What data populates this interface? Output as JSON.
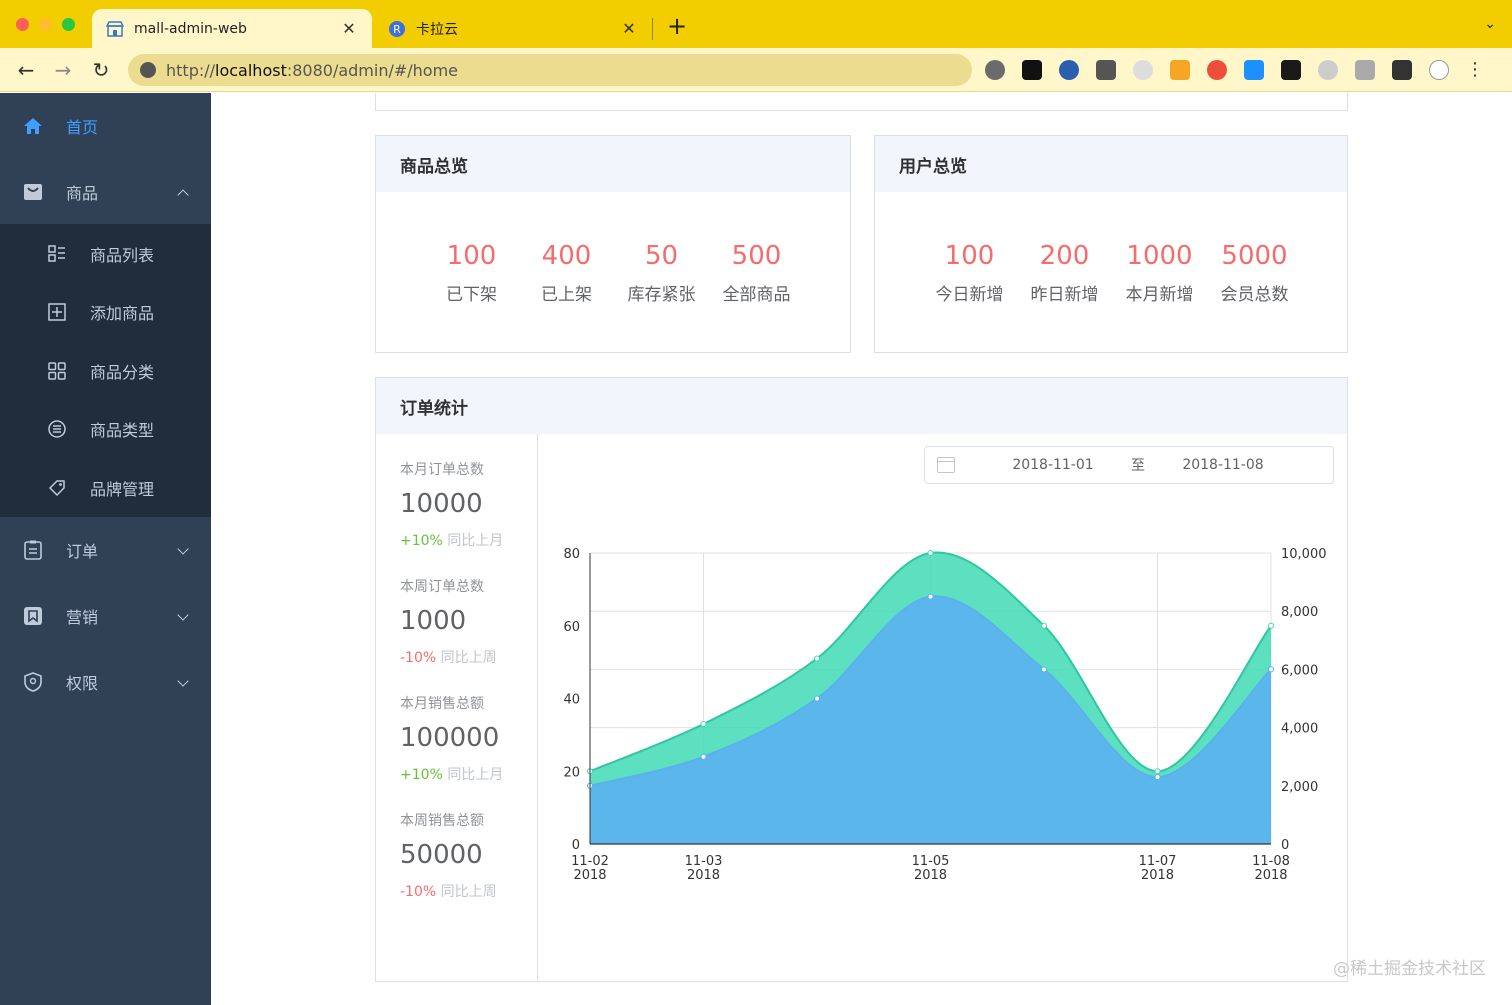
{
  "browser": {
    "tabs": [
      {
        "title": "mall-admin-web",
        "active": true
      },
      {
        "title": "卡拉云",
        "active": false
      }
    ],
    "new_tab": "+",
    "close_glyph": "✕",
    "url_prefix": "http://",
    "url_host": "localhost",
    "url_rest": ":8080/admin/#/home",
    "extensions": [
      "tomato-icon",
      "notion-icon",
      "password-icon",
      "mail-icon",
      "leaf-icon",
      "grid-icon",
      "translate-icon",
      "blue-ext-icon",
      "dark-ext-icon",
      "cloud-icon",
      "chat-icon",
      "puzzle-icon",
      "avatar-icon"
    ]
  },
  "sidebar": {
    "items": [
      {
        "label": "首页",
        "icon": "home-icon",
        "active": true
      },
      {
        "label": "商品",
        "icon": "bag-icon",
        "expanded": true
      },
      {
        "label": "订单",
        "icon": "clipboard-icon"
      },
      {
        "label": "营销",
        "icon": "bookmark-icon"
      },
      {
        "label": "权限",
        "icon": "shield-icon"
      }
    ],
    "sub_items": [
      {
        "label": "商品列表",
        "icon": "list-icon"
      },
      {
        "label": "添加商品",
        "icon": "add-square-icon"
      },
      {
        "label": "商品分类",
        "icon": "grid-icon"
      },
      {
        "label": "商品类型",
        "icon": "menu-circle-icon"
      },
      {
        "label": "品牌管理",
        "icon": "tag-icon"
      }
    ],
    "colors": {
      "bg": "#304156",
      "sub_bg": "#1f2d3d",
      "text": "#bfcbd9",
      "active": "#409eff"
    }
  },
  "product_overview": {
    "title": "商品总览",
    "stats": [
      {
        "value": "100",
        "label": "已下架"
      },
      {
        "value": "400",
        "label": "已上架"
      },
      {
        "value": "50",
        "label": "库存紧张"
      },
      {
        "value": "500",
        "label": "全部商品"
      }
    ]
  },
  "user_overview": {
    "title": "用户总览",
    "stats": [
      {
        "value": "100",
        "label": "今日新增"
      },
      {
        "value": "200",
        "label": "昨日新增"
      },
      {
        "value": "1000",
        "label": "本月新增"
      },
      {
        "value": "5000",
        "label": "会员总数"
      }
    ]
  },
  "order_stats": {
    "title": "订单统计",
    "items": [
      {
        "title": "本月订单总数",
        "value": "10000",
        "pct": "+10%",
        "cmp": "同比上月",
        "trend": "up"
      },
      {
        "title": "本周订单总数",
        "value": "1000",
        "pct": "-10%",
        "cmp": "同比上周",
        "trend": "down"
      },
      {
        "title": "本月销售总额",
        "value": "100000",
        "pct": "+10%",
        "cmp": "同比上月",
        "trend": "up"
      },
      {
        "title": "本周销售总额",
        "value": "50000",
        "pct": "-10%",
        "cmp": "同比上周",
        "trend": "down"
      }
    ],
    "date_range": {
      "start": "2018-11-01",
      "separator": "至",
      "end": "2018-11-08"
    }
  },
  "chart_data": {
    "type": "area",
    "x": [
      "2018-11-02",
      "2018-11-03",
      "2018-11-04",
      "2018-11-05",
      "2018-11-06",
      "2018-11-07",
      "2018-11-08"
    ],
    "x_tick_labels": [
      {
        "top": "11-02",
        "bottom": "2018",
        "x": "2018-11-02"
      },
      {
        "top": "11-03",
        "bottom": "2018",
        "x": "2018-11-03"
      },
      {
        "top": "11-05",
        "bottom": "2018",
        "x": "2018-11-05"
      },
      {
        "top": "11-07",
        "bottom": "2018",
        "x": "2018-11-07"
      },
      {
        "top": "11-08",
        "bottom": "2018",
        "x": "2018-11-08"
      }
    ],
    "series": [
      {
        "axis": "left",
        "color": "#3fdbb4",
        "values": [
          20,
          33,
          51,
          80,
          60,
          20,
          60
        ]
      },
      {
        "axis": "right",
        "color": "#5ab1ef",
        "values": [
          2000,
          3000,
          5000,
          8500,
          6000,
          2300,
          6000
        ]
      }
    ],
    "y_left": {
      "min": 0,
      "max": 80,
      "ticks": [
        "0",
        "20",
        "40",
        "60",
        "80"
      ]
    },
    "y_right": {
      "min": 0,
      "max": 10000,
      "ticks": [
        "0",
        "2,000",
        "4,000",
        "6,000",
        "8,000",
        "10,000"
      ]
    },
    "grid": true
  },
  "watermark": "@稀土掘金技术社区"
}
